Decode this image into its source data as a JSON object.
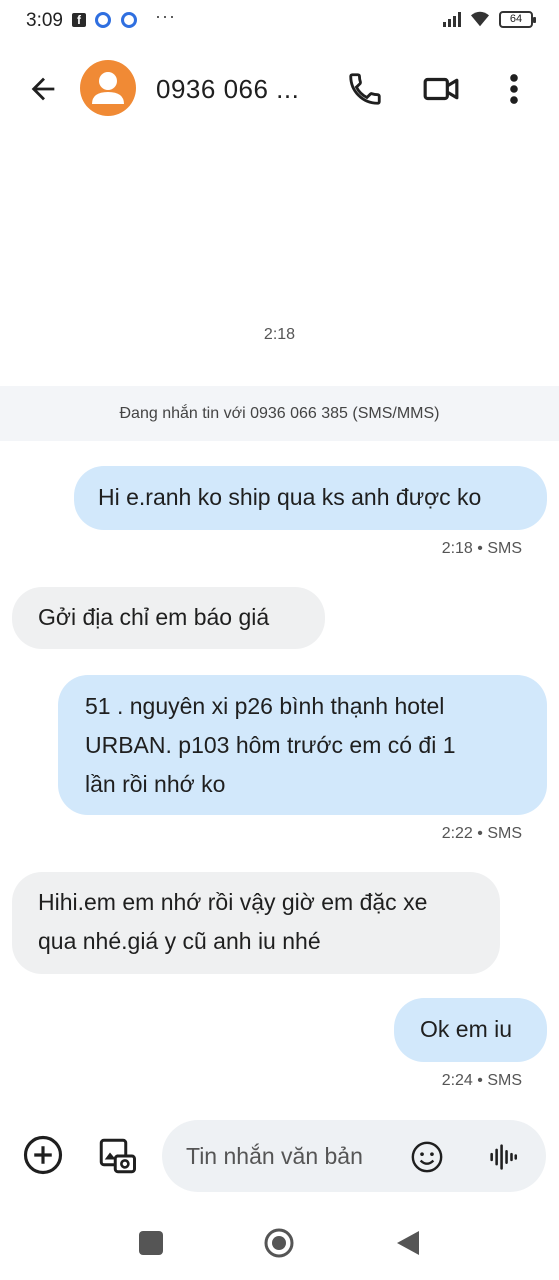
{
  "status_bar": {
    "time": "3:09",
    "fb_letter": "f",
    "more_dots": "···",
    "battery_level": "64",
    "icons": [
      "facebook-icon",
      "app-notification-icon",
      "app-notification-icon",
      "signal-icon",
      "wifi-icon",
      "battery-icon"
    ]
  },
  "header": {
    "contact_name": "0936 066 ...",
    "icons": [
      "back-arrow-icon",
      "avatar-person-icon",
      "phone-icon",
      "video-call-icon",
      "more-vert-icon"
    ]
  },
  "conversation": {
    "time_separator": "2:18",
    "info_banner": "Đang nhắn tin với 0936 066 385 (SMS/MMS)",
    "messages": [
      {
        "direction": "out",
        "lines": [
          "Hi e.ranh ko ship qua ks anh được ko"
        ],
        "meta": "2:18 • SMS"
      },
      {
        "direction": "in",
        "lines": [
          "Gởi địa chỉ em báo giá"
        ]
      },
      {
        "direction": "out",
        "lines": [
          "51 . nguyên xi p26 bình thạnh hotel",
          "URBAN. p103 hôm trước em có đi 1",
          "lần rồi nhớ ko"
        ],
        "meta": "2:22 • SMS"
      },
      {
        "direction": "in",
        "lines": [
          "Hihi.em em nhớ rồi vậy giờ em đặc xe",
          "qua nhé.giá y cũ anh iu nhé"
        ]
      },
      {
        "direction": "out",
        "lines": [
          "Ok em iu"
        ],
        "meta": "2:24 • SMS"
      }
    ]
  },
  "compose": {
    "placeholder": "Tin nhắn văn bản",
    "icons": [
      "add-circle-icon",
      "gallery-camera-icon",
      "emoji-icon",
      "voice-waveform-icon"
    ]
  },
  "colors": {
    "outgoing_bubble": "#d2e8fb",
    "incoming_bubble": "#eff0f1",
    "avatar": "#f08a35",
    "banner": "#f3f5f8",
    "compose_field": "#eef1f4"
  }
}
